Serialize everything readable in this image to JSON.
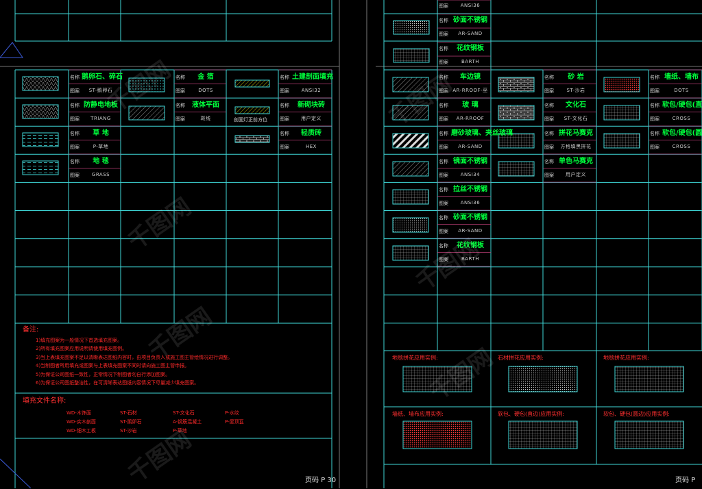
{
  "colors": {
    "grid": "#3fd9d9",
    "name": "#00ff3c",
    "red": "#ff2a2a",
    "magenta": "#e040a0",
    "yellow": "#e6e600"
  },
  "labels": {
    "name_label": "名称",
    "pattern_label": "图案"
  },
  "left_page": {
    "col1": [
      {
        "name": "鹅卵石、碎石",
        "pattern": "ST-鹅卵石"
      },
      {
        "name": "防静电地板",
        "pattern": "TRIANG"
      },
      {
        "name": "草  地",
        "pattern": "P-草地"
      },
      {
        "name": "地  毯",
        "pattern": "GRASS"
      }
    ],
    "col2": [
      {
        "name": "金  箔",
        "pattern": "DOTS"
      },
      {
        "name": "液体平面",
        "pattern": "斑线"
      }
    ],
    "col3": [
      {
        "name": "土建剖面填充",
        "pattern": "ANSI32"
      },
      {
        "name": "新砌块砖",
        "pattern": "用户定义"
      },
      {
        "name": "轻质砖",
        "pattern": "HEX"
      }
    ],
    "col3_side_label": "剖面灯正前方位",
    "notes_title": "备注:",
    "notes": [
      "1)填充图案为一般情况下首选填充图案。",
      "2)所有填充图案应用说明请使用填充图例。",
      "3)当上表填充图案不足以清晰表达图纸内容时，由项目负责人或施工图主管绘情况进行调整。",
      "4)当制图者所用填充或图案与上表填充图案不同时请向施工图主管申报。",
      "5)为保证公司图纸一致性，正常情况下制图者勿自行添加图案。",
      "6)为保证公司图纸整洁性，在可清晰表达图纸内容情况下尽量减少填充图案。"
    ],
    "files_title": "填充文件名称:",
    "files": [
      [
        "WD-木饰面",
        "ST-石材",
        "ST-文化石",
        "P-水纹"
      ],
      [
        "WD-实木剖面",
        "ST-鹅卵石",
        "A-钢筋混凝土",
        "P-屋顶瓦"
      ],
      [
        "WD-细木工板",
        "ST-沙岩",
        "P-草地",
        ""
      ]
    ],
    "page": "页码   P 30"
  },
  "right_page": {
    "top_rows": [
      {
        "name": "",
        "pattern": "ANSI36"
      },
      {
        "name": "砂面不锈钢",
        "pattern": "AR-SAND"
      },
      {
        "name": "花纹钢板",
        "pattern": "BARTH"
      }
    ],
    "col1": [
      {
        "name": "车边镜",
        "pattern": "AR-RROOF-巫"
      },
      {
        "name": "玻  璃",
        "pattern": "AR-RROOF"
      },
      {
        "name": "磨砂玻璃、夹丝玻璃",
        "pattern": "AR-SAND"
      },
      {
        "name": "镜面不锈钢",
        "pattern": "ANSI34"
      },
      {
        "name": "拉丝不锈钢",
        "pattern": "ANSI36"
      },
      {
        "name": "砂面不锈钢",
        "pattern": "AR-SAND"
      },
      {
        "name": "花纹钢板",
        "pattern": "BARTH"
      }
    ],
    "col2": [
      {
        "name": "砂  岩",
        "pattern": "ST-沙岩"
      },
      {
        "name": "文化石",
        "pattern": "ST-文化石"
      },
      {
        "name": "拼花马赛克",
        "pattern": "方格填黑拼花"
      },
      {
        "name": "单色马赛克",
        "pattern": "用户定义"
      }
    ],
    "col3": [
      {
        "name": "墙纸、墙布",
        "pattern": "DOTS"
      },
      {
        "name": "软包/硬包(直边)",
        "pattern": "CROSS"
      },
      {
        "name": "软包/硬包(圆边)",
        "pattern": "CROSS"
      }
    ],
    "examples": [
      "地毯拼花应用实例:",
      "石材拼花应用实例:",
      "地毯拼花应用实例:",
      "墙纸、墙布应用实例:",
      "软包、硬包(直边)应用实例:",
      "软包、硬包(圆边)应用实例:"
    ],
    "page": "页码   P"
  },
  "watermark": "千图网"
}
